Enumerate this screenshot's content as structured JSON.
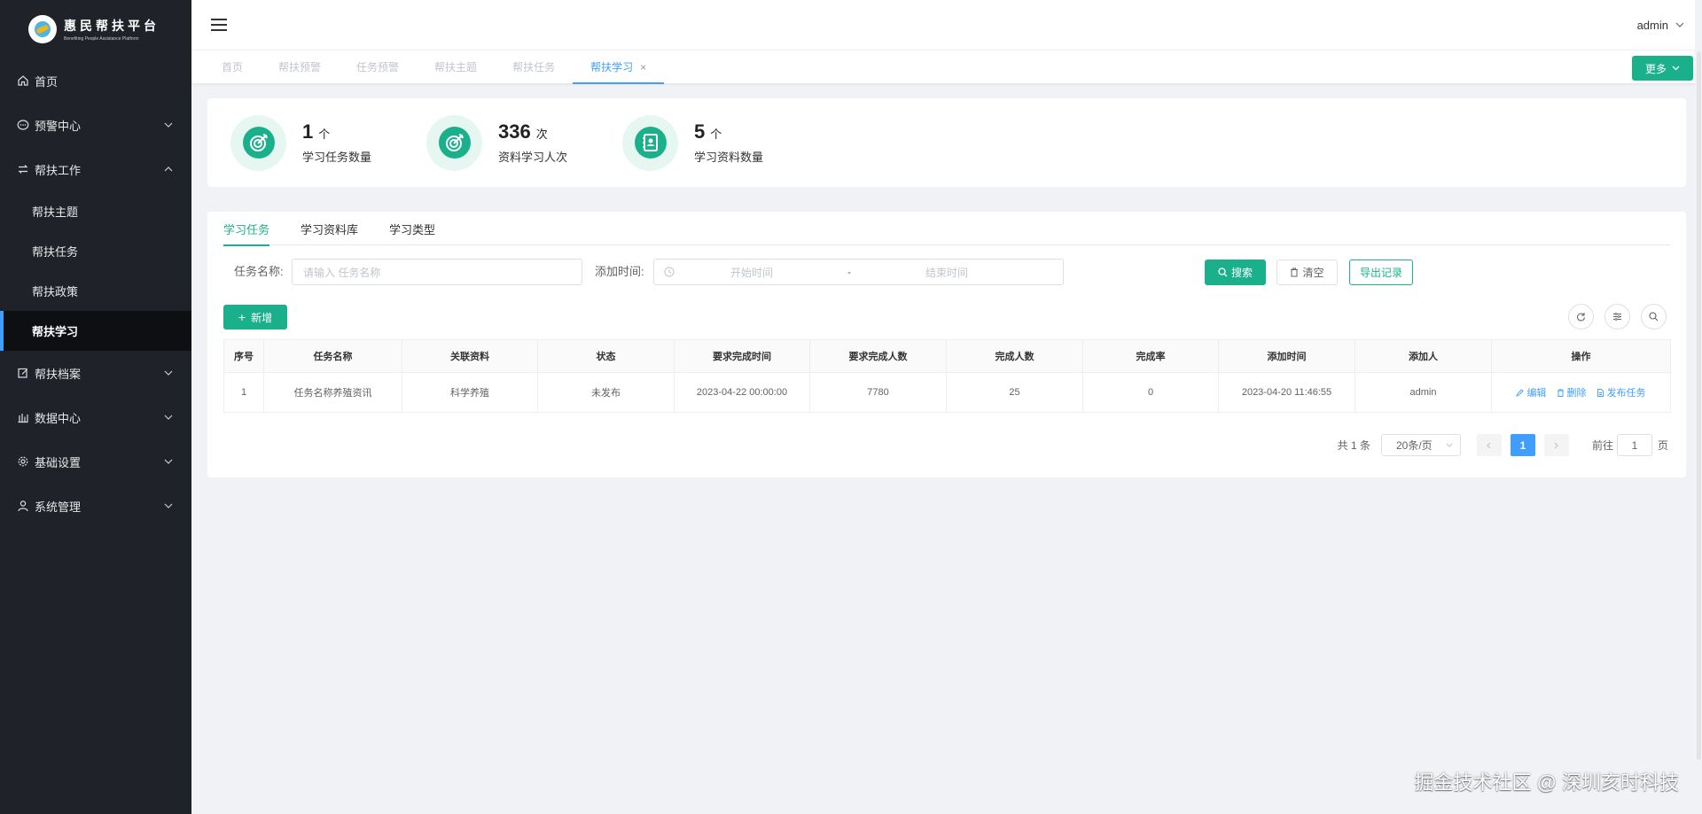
{
  "app": {
    "title_cn": "惠民帮扶平台",
    "title_en": "Benefiting People Assistance Platform"
  },
  "sidebar": {
    "items": [
      {
        "label": "首页",
        "icon": "home-icon"
      },
      {
        "label": "预警中心",
        "icon": "message-icon"
      },
      {
        "label": "帮扶工作",
        "icon": "transfer-icon",
        "expanded": true,
        "children": [
          {
            "label": "帮扶主题"
          },
          {
            "label": "帮扶任务"
          },
          {
            "label": "帮扶政策"
          },
          {
            "label": "帮扶学习",
            "active": true
          }
        ]
      },
      {
        "label": "帮扶档案",
        "icon": "edit-icon"
      },
      {
        "label": "数据中心",
        "icon": "chart-icon"
      },
      {
        "label": "基础设置",
        "icon": "gear-icon"
      },
      {
        "label": "系统管理",
        "icon": "user-icon"
      }
    ]
  },
  "header": {
    "username": "admin"
  },
  "page_tabs": [
    {
      "label": "首页"
    },
    {
      "label": "帮扶预警"
    },
    {
      "label": "任务预警"
    },
    {
      "label": "帮扶主题"
    },
    {
      "label": "帮扶任务"
    },
    {
      "label": "帮扶学习",
      "active": true,
      "closable": true
    }
  ],
  "more_button": "更多",
  "stats": [
    {
      "value": "1",
      "unit": "个",
      "label": "学习任务数量",
      "icon": "target-icon"
    },
    {
      "value": "336",
      "unit": "次",
      "label": "资料学习人次",
      "icon": "target-icon"
    },
    {
      "value": "5",
      "unit": "个",
      "label": "学习资料数量",
      "icon": "contact-book-icon"
    }
  ],
  "inner_tabs": [
    {
      "label": "学习任务",
      "active": true
    },
    {
      "label": "学习资料库"
    },
    {
      "label": "学习类型"
    }
  ],
  "filters": {
    "task_name_label": "任务名称:",
    "task_name_placeholder": "请输入 任务名称",
    "add_time_label": "添加时间:",
    "start_placeholder": "开始时间",
    "range_separator": "-",
    "end_placeholder": "结束时间",
    "search_button": "搜索",
    "clear_button": "清空",
    "export_button": "导出记录"
  },
  "add_button": "新增",
  "table": {
    "columns": [
      "序号",
      "任务名称",
      "关联资料",
      "状态",
      "要求完成时间",
      "要求完成人数",
      "完成人数",
      "完成率",
      "添加时间",
      "添加人",
      "操作"
    ],
    "rows": [
      [
        "1",
        "任务名称养殖资讯",
        "科学养殖",
        "未发布",
        "2023-04-22 00:00:00",
        "7780",
        "25",
        "0",
        "2023-04-20 11:46:55",
        "admin"
      ]
    ],
    "actions": [
      "编辑",
      "删除",
      "发布任务"
    ]
  },
  "pagination": {
    "total": "共 1 条",
    "page_size": "20条/页",
    "current_page": "1",
    "goto_label": "前往",
    "goto_value": "1",
    "page_suffix": "页"
  },
  "watermark": "掘金技术社区 @ 深圳亥时科技",
  "colors": {
    "sidebar_bg": "#1f2229",
    "accent_green": "#1bb08c",
    "link_blue": "#409eff"
  }
}
